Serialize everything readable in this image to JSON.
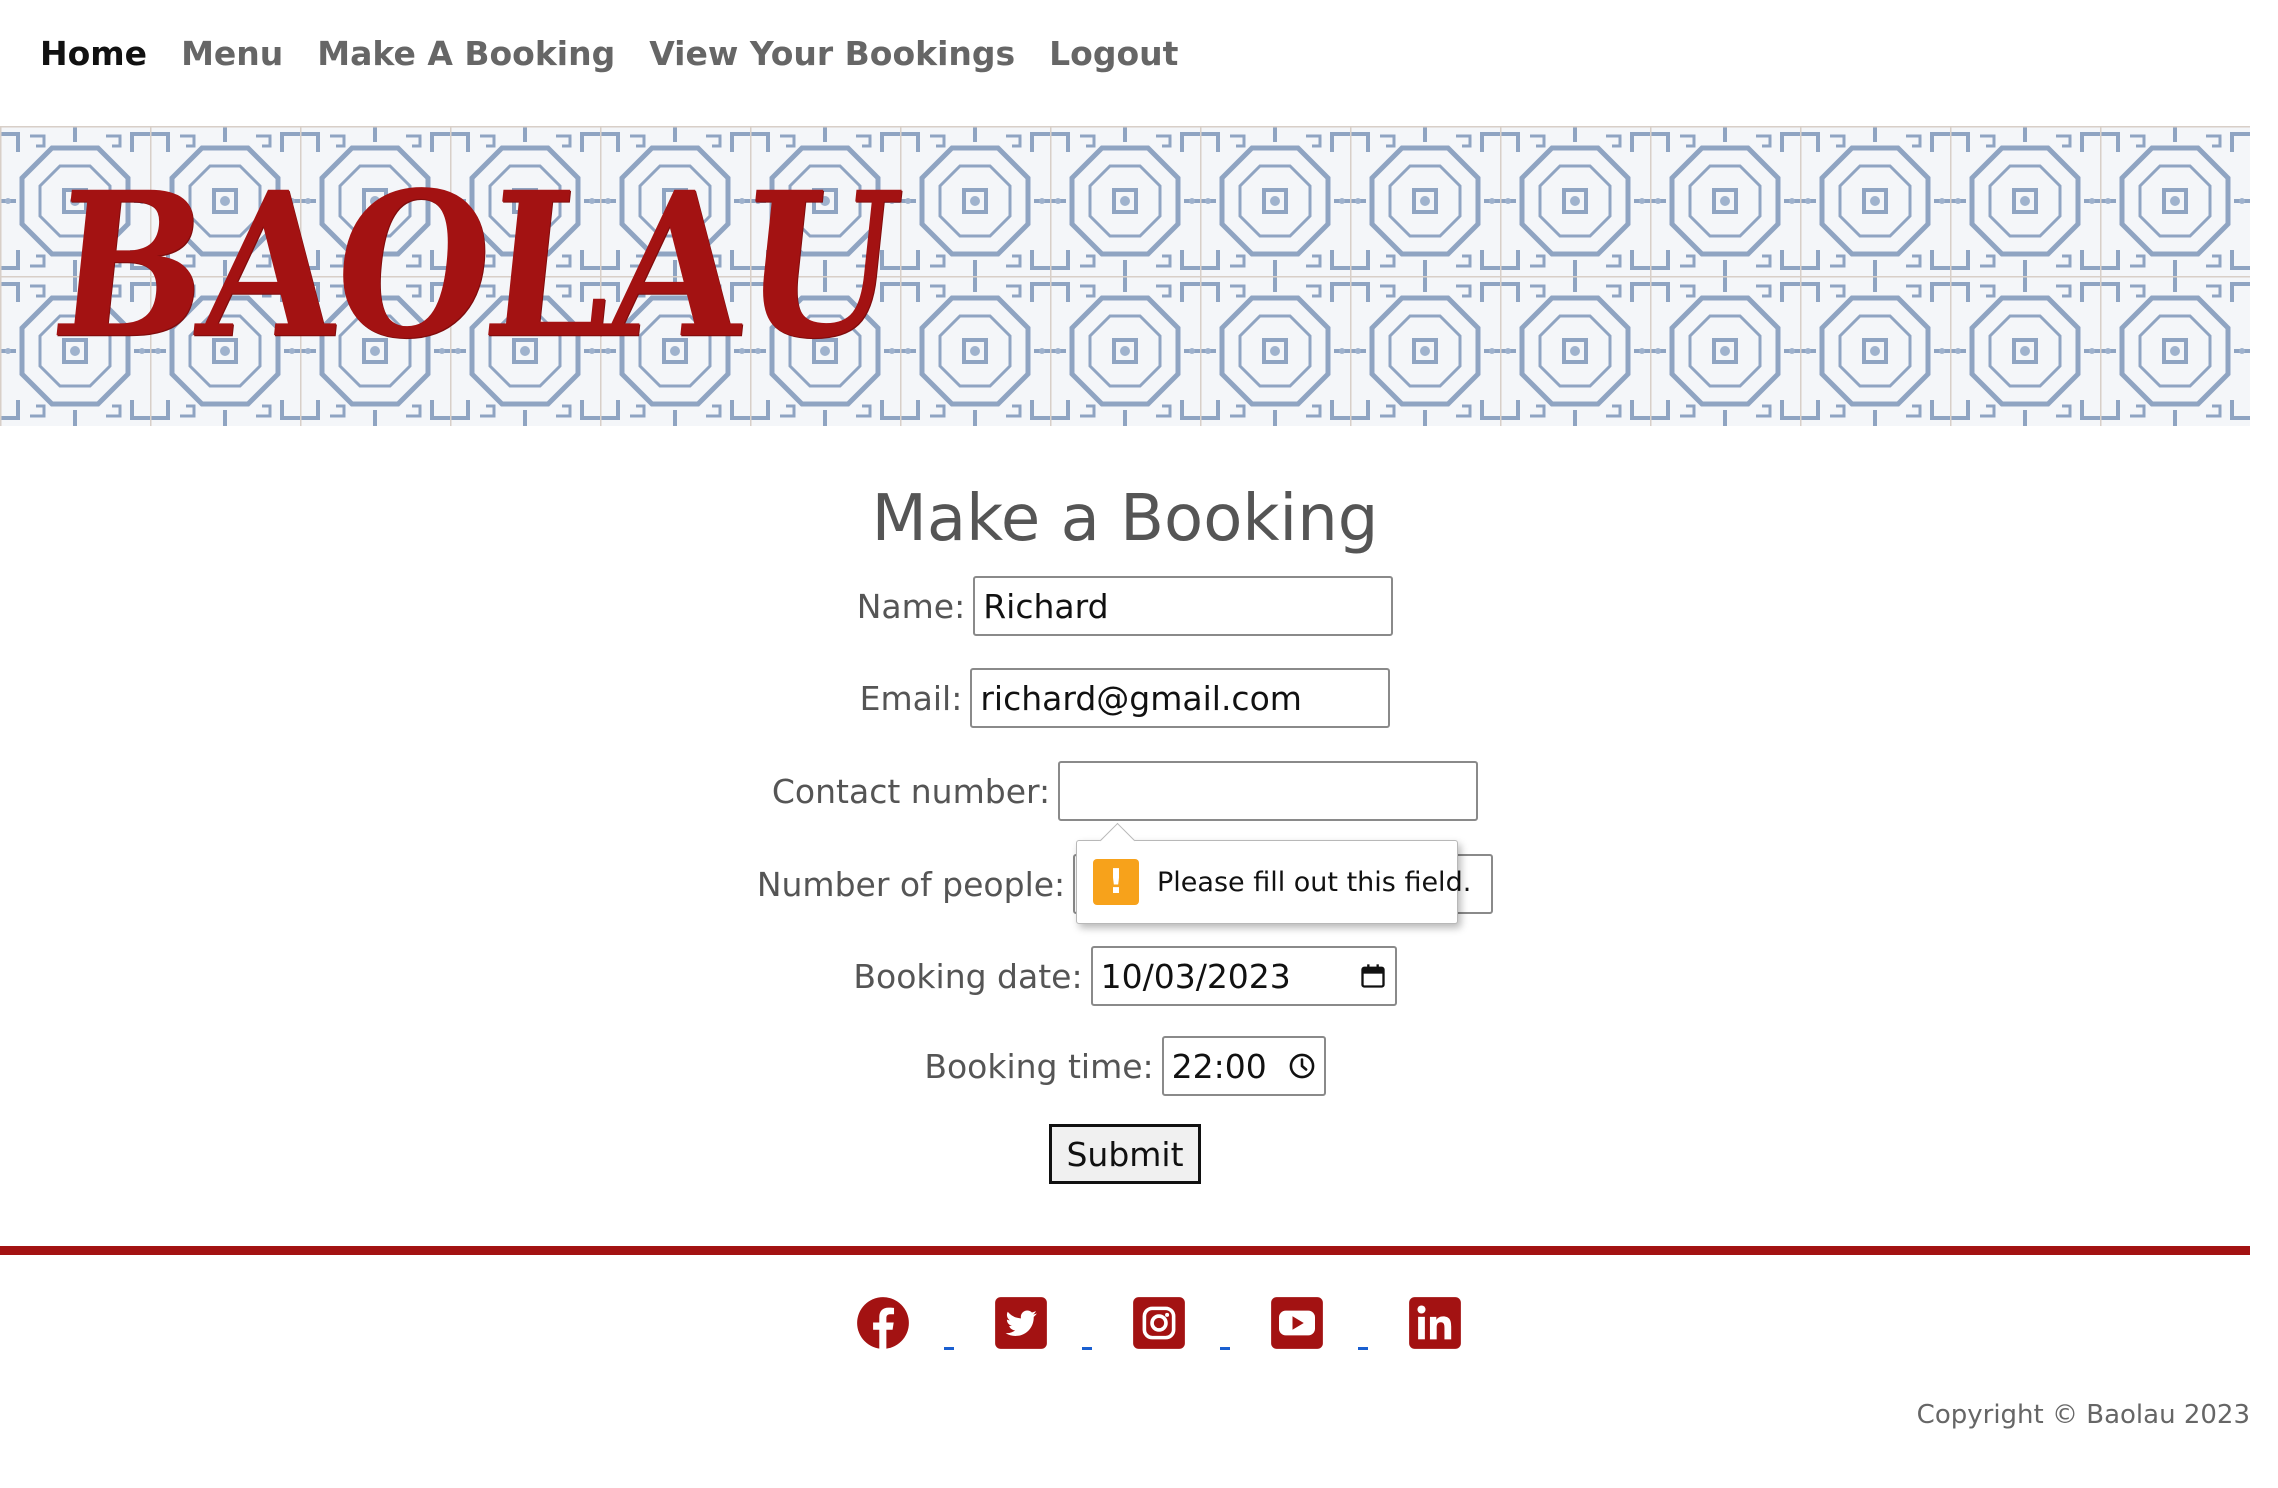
{
  "nav": {
    "items": [
      {
        "label": "Home",
        "active": true
      },
      {
        "label": "Menu",
        "active": false
      },
      {
        "label": "Make A Booking",
        "active": false
      },
      {
        "label": "View Your Bookings",
        "active": false
      },
      {
        "label": "Logout",
        "active": false
      }
    ]
  },
  "hero": {
    "title": "BAOLAU"
  },
  "form": {
    "title": "Make a Booking",
    "name": {
      "label": "Name:",
      "value": "Richard"
    },
    "email": {
      "label": "Email:",
      "value": "richard@gmail.com"
    },
    "contact": {
      "label": "Contact number:",
      "value": ""
    },
    "people": {
      "label": "Number of people:",
      "value": ""
    },
    "date": {
      "label": "Booking date:",
      "value": "10/03/2023"
    },
    "time": {
      "label": "Booking time:",
      "value": "22:00"
    },
    "submit_label": "Submit"
  },
  "validation": {
    "message": "Please fill out this field.",
    "icon": "warning-icon"
  },
  "footer": {
    "social_icons": [
      "facebook-icon",
      "twitter-icon",
      "instagram-icon",
      "youtube-icon",
      "linkedin-icon"
    ],
    "copyright": "Copyright © Baolau 2023"
  },
  "colors": {
    "brand_red": "#a31212",
    "tile_blue": "#8fa4c2",
    "warning_orange": "#f7a21b"
  }
}
